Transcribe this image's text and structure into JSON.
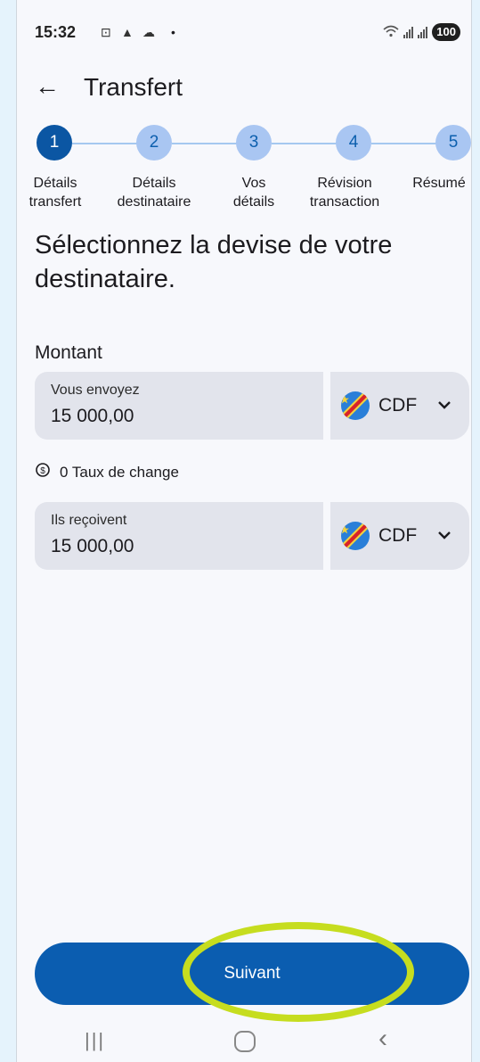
{
  "status_bar": {
    "time": "15:32",
    "battery": "100",
    "notif_icons": [
      "screenshot-icon",
      "warning-icon",
      "cloud-icon"
    ]
  },
  "header": {
    "back_glyph": "←",
    "title": "Transfert"
  },
  "stepper": {
    "steps": [
      {
        "number": "1",
        "label_line1": "Détails",
        "label_line2": "transfert",
        "active": true
      },
      {
        "number": "2",
        "label_line1": "Détails",
        "label_line2": "destinataire",
        "active": false
      },
      {
        "number": "3",
        "label_line1": "Vos",
        "label_line2": "détails",
        "active": false
      },
      {
        "number": "4",
        "label_line1": "Révision",
        "label_line2": "transaction",
        "active": false
      },
      {
        "number": "5",
        "label_line1": "Résumé",
        "label_line2": "",
        "active": false
      }
    ]
  },
  "main": {
    "heading": "Sélectionnez la devise de votre destinataire.",
    "amount_section_label": "Montant",
    "send": {
      "label": "Vous envoyez",
      "value": "15 000,00",
      "currency": "CDF"
    },
    "exchange_rate": "0 Taux de change",
    "receive": {
      "label": "Ils reçoivent",
      "value": "15 000,00",
      "currency": "CDF"
    }
  },
  "footer": {
    "next_label": "Suivant"
  },
  "colors": {
    "primary": "#0b5db0",
    "step_inactive": "#a9c6f2",
    "highlight": "#c6dd1f",
    "field_bg": "#e2e4ec"
  }
}
